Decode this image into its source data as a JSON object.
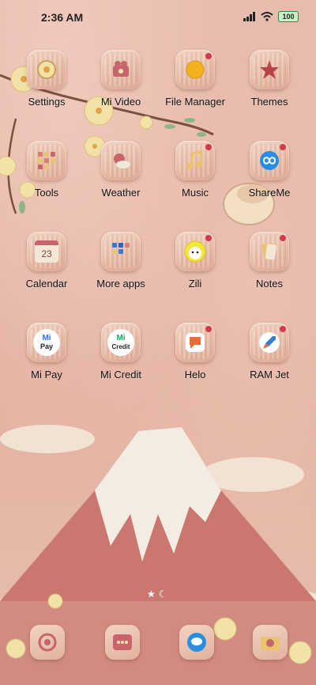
{
  "status_bar": {
    "time": "2:36 AM",
    "battery": "100",
    "icons": [
      "signal-icon",
      "wifi-icon",
      "battery-icon"
    ]
  },
  "apps": [
    {
      "label": "Settings"
    },
    {
      "label": "Mi Video"
    },
    {
      "label": "File Manager"
    },
    {
      "label": "Themes"
    },
    {
      "label": "Tools"
    },
    {
      "label": "Weather"
    },
    {
      "label": "Music"
    },
    {
      "label": "ShareMe"
    },
    {
      "label": "Calendar",
      "icon_text": "23"
    },
    {
      "label": "More apps"
    },
    {
      "label": "Zili"
    },
    {
      "label": "Notes"
    },
    {
      "label": "Mi Pay",
      "icon_text_top": "Mi",
      "icon_text_bottom": "Pay"
    },
    {
      "label": "Mi Credit",
      "icon_text_top": "Mi",
      "icon_text_bottom": "Credit"
    },
    {
      "label": "Helo"
    },
    {
      "label": "RAM Jet"
    }
  ],
  "dock": [
    "phone-icon",
    "messages-icon",
    "chat-icon",
    "camera-icon"
  ],
  "colors": {
    "wallpaper": "#e6b6a6",
    "notification_dot": "#d23b4a"
  }
}
